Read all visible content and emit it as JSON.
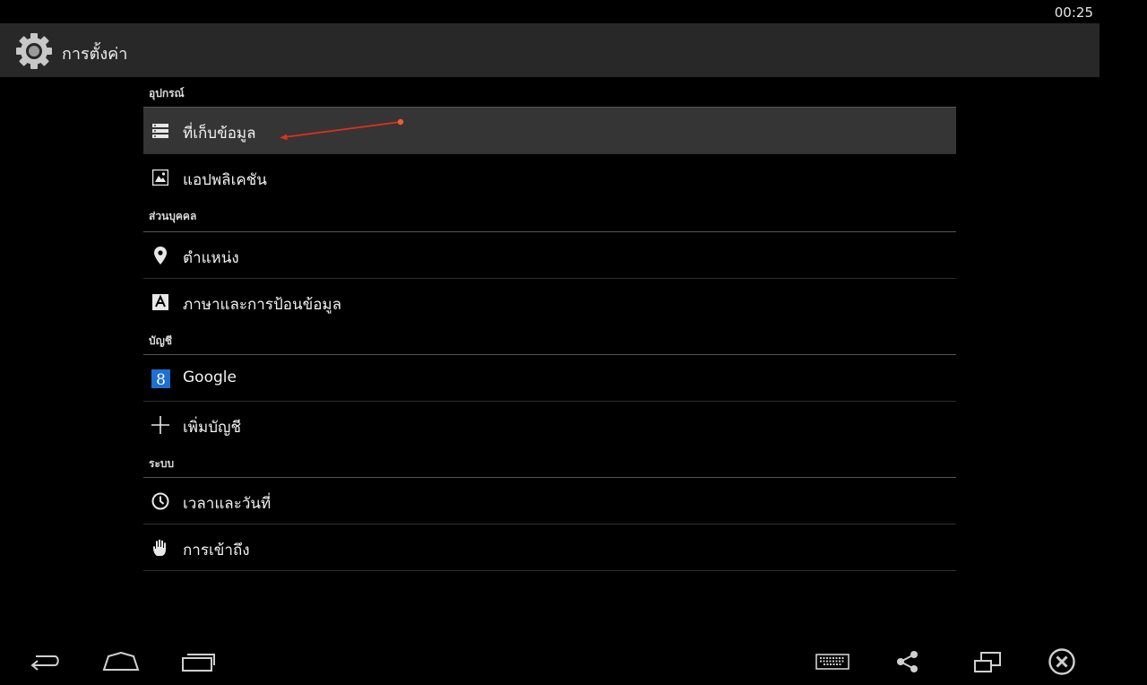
{
  "status_bar": {
    "time": "00:25"
  },
  "action_bar": {
    "title": "การตั้งค่า",
    "icon": "gear-icon"
  },
  "sections": {
    "device": {
      "header": "อุปกรณ์",
      "items": [
        {
          "label": "ที่เก็บข้อมูล",
          "icon": "storage-icon",
          "selected": true
        },
        {
          "label": "แอปพลิเคชัน",
          "icon": "apps-icon"
        }
      ]
    },
    "personal": {
      "header": "ส่วนบุคคล",
      "items": [
        {
          "label": "ตำแหน่ง",
          "icon": "location-pin-icon"
        },
        {
          "label": "ภาษาและการป้อนข้อมูล",
          "icon": "language-input-icon"
        }
      ]
    },
    "accounts": {
      "header": "บัญชี",
      "items": [
        {
          "label": "Google",
          "icon": "google-icon"
        },
        {
          "label": "เพิ่มบัญชี",
          "icon": "plus-icon"
        }
      ]
    },
    "system": {
      "header": "ระบบ",
      "items": [
        {
          "label": "เวลาและวันที่",
          "icon": "clock-icon"
        },
        {
          "label": "การเข้าถึง",
          "icon": "hand-icon"
        }
      ]
    }
  },
  "nav_bar": {
    "buttons": [
      "back-icon",
      "home-icon",
      "recent-apps-icon",
      "keyboard-icon",
      "share-icon",
      "window-icon",
      "close-icon"
    ]
  },
  "colors": {
    "background": "#000000",
    "action_bar": "#282828",
    "selected_row": "#353535",
    "annotation_arrow": "#e0301e",
    "google_icon_bg": "#1e6fd0"
  }
}
